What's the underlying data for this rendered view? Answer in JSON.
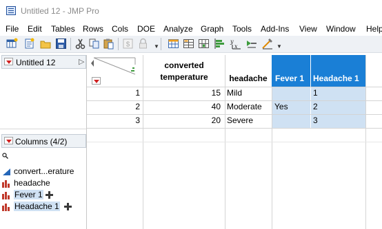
{
  "window": {
    "title": "Untitled 12 - JMP Pro"
  },
  "menu": [
    "File",
    "Edit",
    "Tables",
    "Rows",
    "Cols",
    "DOE",
    "Analyze",
    "Graph",
    "Tools",
    "Add-Ins",
    "View",
    "Window",
    "Help"
  ],
  "table_panel": {
    "title": "Untitled 12"
  },
  "columns_panel": {
    "title": "Columns (4/2)",
    "search_icon": "search-icon",
    "items": [
      {
        "label": "convert...erature",
        "icon": "continuous-icon",
        "selected": false
      },
      {
        "label": "headache",
        "icon": "nominal-icon",
        "selected": false
      },
      {
        "label": "Fever 1",
        "icon": "nominal-icon",
        "selected": true
      },
      {
        "label": "Headache 1",
        "icon": "nominal-icon",
        "selected": true
      }
    ]
  },
  "grid": {
    "headers": [
      {
        "label_line1": "converted",
        "label_line2": "temperature",
        "selected": false
      },
      {
        "label_line1": "headache",
        "label_line2": "",
        "selected": false
      },
      {
        "label_line1": "Fever 1",
        "label_line2": "",
        "selected": true
      },
      {
        "label_line1": "Headache 1",
        "label_line2": "",
        "selected": true
      }
    ],
    "rows": [
      {
        "row": "1",
        "cells": [
          "15",
          "Mild",
          "",
          "1"
        ]
      },
      {
        "row": "2",
        "cells": [
          "40",
          "Moderate",
          "Yes",
          "2"
        ]
      },
      {
        "row": "3",
        "cells": [
          "20",
          "Severe",
          "",
          "3"
        ]
      }
    ]
  },
  "colors": {
    "selected_header": "#1a7fd6",
    "selected_cells": "#cfe1f3",
    "red_triangle": "#d01f1f"
  }
}
